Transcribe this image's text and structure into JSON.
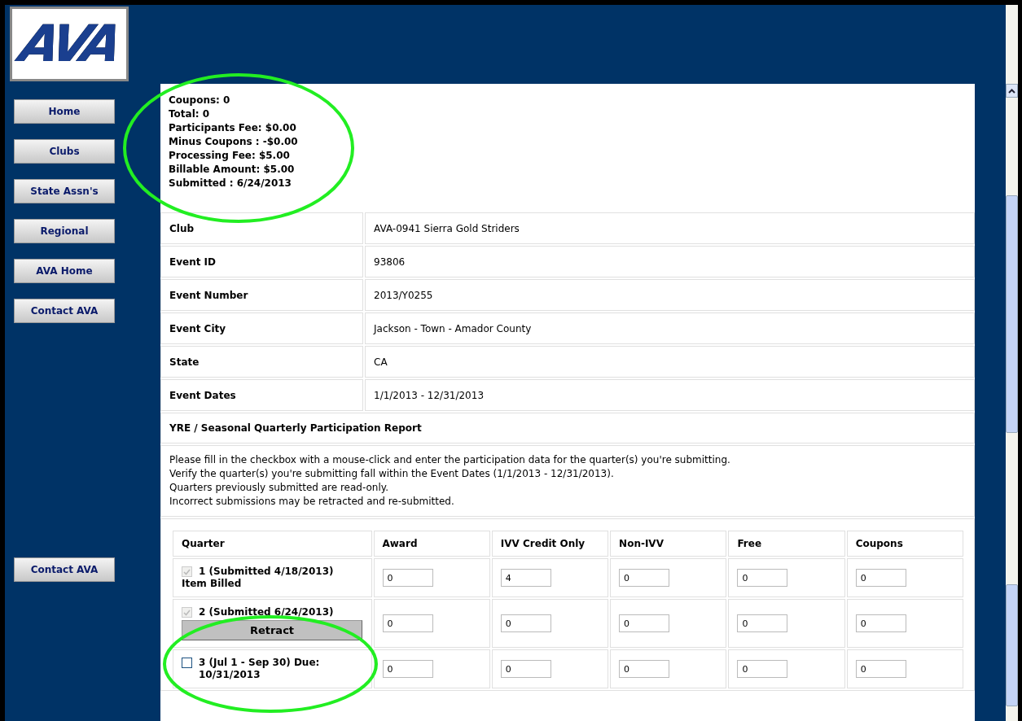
{
  "logo": {
    "text": "AVA"
  },
  "nav": [
    {
      "label": "Home"
    },
    {
      "label": "Clubs"
    },
    {
      "label": "State Assn's"
    },
    {
      "label": "Regional"
    },
    {
      "label": "AVA Home"
    },
    {
      "label": "Contact AVA"
    }
  ],
  "nav_bottom": [
    {
      "label": "Contact AVA"
    }
  ],
  "summary": [
    "Coupons: 0",
    "Total: 0",
    "Participants Fee: $0.00",
    "Minus Coupons : -$0.00",
    "Processing Fee: $5.00",
    "Billable Amount: $5.00",
    "Submitted : 6/24/2013"
  ],
  "details": [
    {
      "label": "Club",
      "value": "AVA-0941 Sierra Gold Striders"
    },
    {
      "label": "Event ID",
      "value": "93806"
    },
    {
      "label": "Event Number",
      "value": "2013/Y0255"
    },
    {
      "label": "Event City",
      "value": "Jackson - Town - Amador County"
    },
    {
      "label": "State",
      "value": "CA"
    },
    {
      "label": "Event Dates",
      "value": "1/1/2013 - 12/31/2013"
    }
  ],
  "report_title": "YRE / Seasonal Quarterly Participation Report",
  "instructions": [
    "Please fill in the checkbox with a mouse-click and enter the participation data for the quarter(s) you're submitting.",
    "Verify the quarter(s) you're submitting fall within the Event Dates (1/1/2013 - 12/31/2013).",
    "Quarters previously submitted are read-only.",
    "Incorrect submissions may be retracted and re-submitted."
  ],
  "quarters": {
    "columns": [
      "Quarter",
      "Award",
      "IVV Credit Only",
      "Non-IVV",
      "Free",
      "Coupons"
    ],
    "rows": [
      {
        "label": "1 (Submitted 4/18/2013)",
        "checked": true,
        "disabled": true,
        "note": "Item Billed",
        "values": [
          "0",
          "4",
          "0",
          "0",
          "0"
        ]
      },
      {
        "label": "2 (Submitted 6/24/2013)",
        "checked": true,
        "disabled": true,
        "button": "Retract",
        "values": [
          "0",
          "0",
          "0",
          "0",
          "0"
        ]
      },
      {
        "label": "3 (Jul 1 - Sep 30) Due: 10/31/2013",
        "checked": false,
        "disabled": false,
        "values": [
          "0",
          "0",
          "0",
          "0",
          "0"
        ]
      }
    ]
  }
}
